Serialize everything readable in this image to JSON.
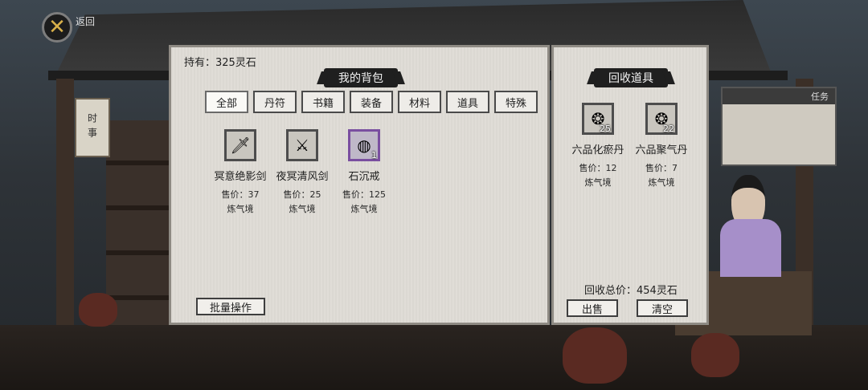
{
  "header": {
    "back_label": "返回"
  },
  "background": {
    "hanging_sign": "时事",
    "quest_sign_head": "任务"
  },
  "bag": {
    "holding": "持有：325灵石",
    "title": "我的背包",
    "tabs": [
      "全部",
      "丹符",
      "书籍",
      "装备",
      "材料",
      "道具",
      "特殊"
    ],
    "active_tab": "全部",
    "items": [
      {
        "name": "冥意绝影剑",
        "price": "售价：37",
        "realm": "炼气境",
        "count": "",
        "icon": "sword-icon",
        "glyph": "🗡"
      },
      {
        "name": "夜冥清风剑",
        "price": "售价：25",
        "realm": "炼气境",
        "count": "",
        "icon": "sword-icon",
        "glyph": "⚔"
      },
      {
        "name": "石沉戒",
        "price": "售价：125",
        "realm": "炼气境",
        "count": "1",
        "icon": "ring-icon",
        "glyph": "◍"
      }
    ],
    "batch_button": "批量操作"
  },
  "recycle": {
    "title": "回收道具",
    "items": [
      {
        "name": "六品化瘀丹",
        "price": "售价：12",
        "realm": "炼气境",
        "count": "25",
        "icon": "pill-icon",
        "glyph": "❂"
      },
      {
        "name": "六品聚气丹",
        "price": "售价：7",
        "realm": "炼气境",
        "count": "22",
        "icon": "pill-icon",
        "glyph": "❂"
      }
    ],
    "total": "回收总价：454灵石",
    "sell_button": "出售",
    "clear_button": "清空"
  }
}
